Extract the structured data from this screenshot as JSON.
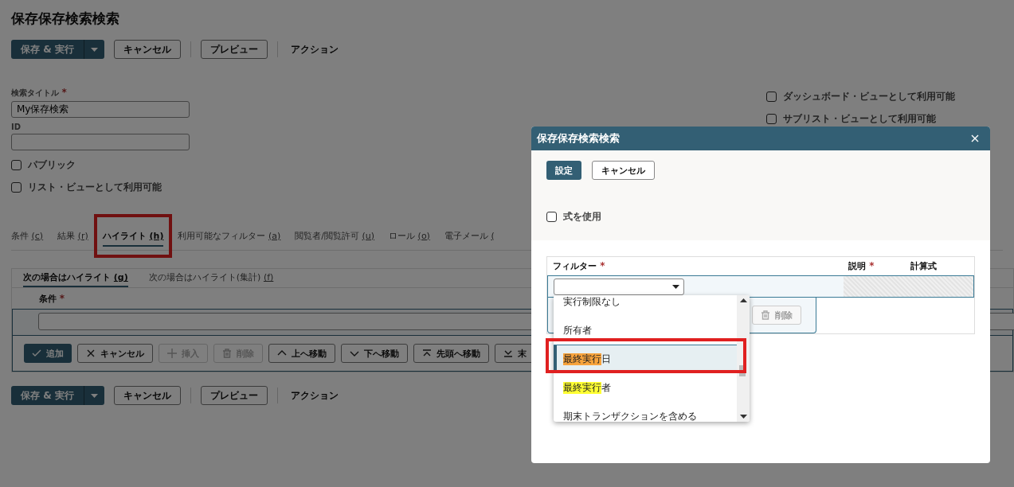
{
  "page_title": "保存保存検索検索",
  "toolbar": {
    "primary": "保存 & 実行",
    "buttons": [
      "キャンセル",
      "プレビュー"
    ],
    "action": "アクション"
  },
  "form": {
    "title_label": "検索タイトル",
    "title_required_mark": "*",
    "title_value": "My保存検索",
    "id_label": "ID",
    "left_checks": [
      {
        "label": "パブリック",
        "checked": false
      },
      {
        "label": "リスト・ビューとして利用可能",
        "checked": false
      }
    ],
    "right_checks": [
      {
        "label": "ダッシュボード・ビューとして利用可能",
        "checked": false
      },
      {
        "label": "サブリスト・ビューとして利用可能",
        "checked": false
      }
    ]
  },
  "tabs": [
    {
      "label": "条件",
      "key": "(c)",
      "selected": false
    },
    {
      "label": "結果",
      "key": "(r)",
      "selected": false
    },
    {
      "label": "ハイライト",
      "key": "(h)",
      "selected": true,
      "annotated": true
    },
    {
      "label": "利用可能なフィルター",
      "key": "(a)",
      "selected": false
    },
    {
      "label": "閲覧者/閲覧許可",
      "key": "(u)",
      "selected": false
    },
    {
      "label": "ロール",
      "key": "(o)",
      "selected": false
    },
    {
      "label": "電子メール",
      "key": "(",
      "selected": false
    }
  ],
  "subtabs": [
    {
      "label": "次の場合はハイライト",
      "key": "(g)",
      "selected": true
    },
    {
      "label": "次の場合はハイライト(集計)",
      "key": "(f)",
      "selected": false
    }
  ],
  "condition_label": "条件",
  "condition_required_mark": "*",
  "row_buttons": [
    {
      "label": "追加",
      "kind": "primary",
      "disabled": false
    },
    {
      "label": "キャンセル",
      "kind": "normal",
      "disabled": false
    },
    {
      "label": "挿入",
      "kind": "normal",
      "disabled": true
    },
    {
      "label": "削除",
      "kind": "normal",
      "disabled": true
    },
    {
      "label": "上へ移動",
      "kind": "normal",
      "disabled": false
    },
    {
      "label": "下へ移動",
      "kind": "normal",
      "disabled": false
    },
    {
      "label": "先頭へ移動",
      "kind": "normal",
      "disabled": false
    },
    {
      "label": "末",
      "kind": "normal",
      "disabled": false
    }
  ],
  "bottom_toolbar": {
    "primary": "保存 & 実行",
    "buttons": [
      "キャンセル",
      "プレビュー"
    ],
    "action": "アクション"
  },
  "dialog": {
    "title": "保存保存検索検索",
    "buttons": [
      {
        "label": "設定",
        "kind": "primary"
      },
      {
        "label": "キャンセル",
        "kind": "normal"
      }
    ],
    "formula_check": {
      "label": "式を使用",
      "checked": false
    },
    "columns": [
      {
        "label": "フィルター",
        "required_mark": "*"
      },
      {
        "label": "説明",
        "required_mark": "*"
      },
      {
        "label": "計算式"
      }
    ],
    "delete_button": {
      "label": "削除",
      "disabled": true
    },
    "options": [
      {
        "rest": "実行制限なし",
        "selected": false
      },
      {
        "rest": "所有者",
        "selected": false
      },
      {
        "highlight": "最終実行",
        "rest": "日",
        "selected": true,
        "annotated": true
      },
      {
        "highlight": "最終実行",
        "rest": "者",
        "selected": false
      },
      {
        "rest": "期末トランザクションを含める",
        "selected": false
      }
    ]
  }
}
